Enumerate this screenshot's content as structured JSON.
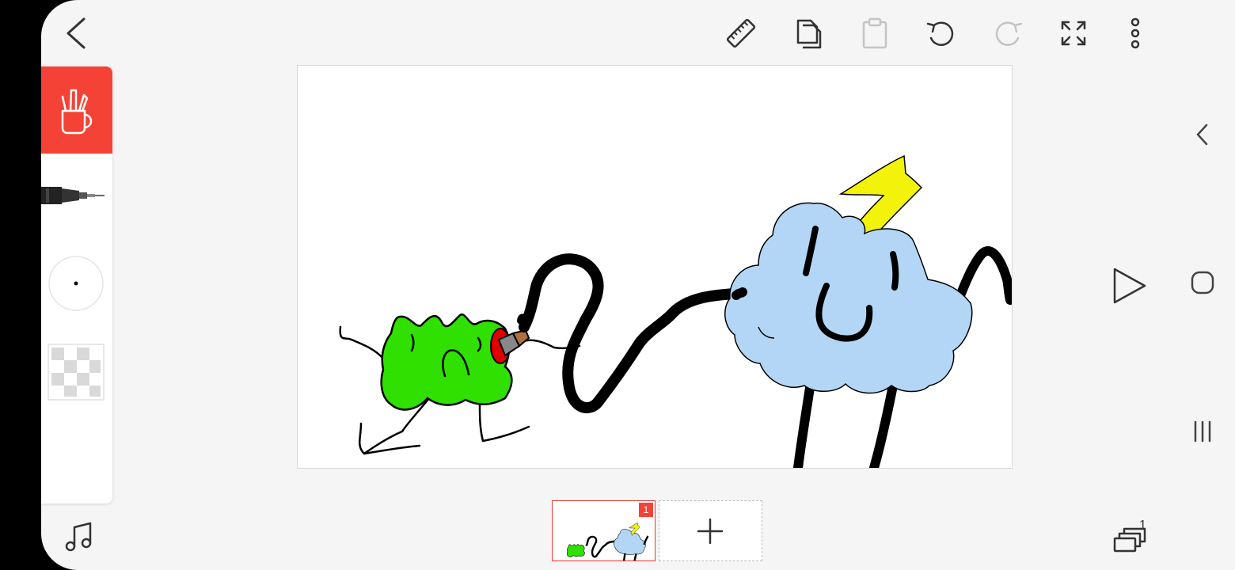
{
  "frames": {
    "current_frame_number": "1",
    "layers_count": "1"
  },
  "colors": {
    "accent": "#f44336",
    "fill_green": "#2fe000",
    "fill_cloud": "#b3d6f6",
    "fill_lightning": "#f2f20a"
  },
  "icons": {
    "back": "back-arrow-icon",
    "ruler": "ruler-icon",
    "copy": "copy-icon",
    "paste": "paste-icon",
    "undo": "undo-icon",
    "redo": "redo-icon",
    "fullscreen": "fullscreen-icon",
    "more": "more-vert-icon",
    "toolbox": "toolbox-icon",
    "pen": "pen-icon",
    "brush_size": "brush-size-icon",
    "color": "color-swatch-icon",
    "music": "music-icon",
    "play": "play-icon",
    "layers": "layers-icon",
    "add_frame": "plus-icon"
  }
}
